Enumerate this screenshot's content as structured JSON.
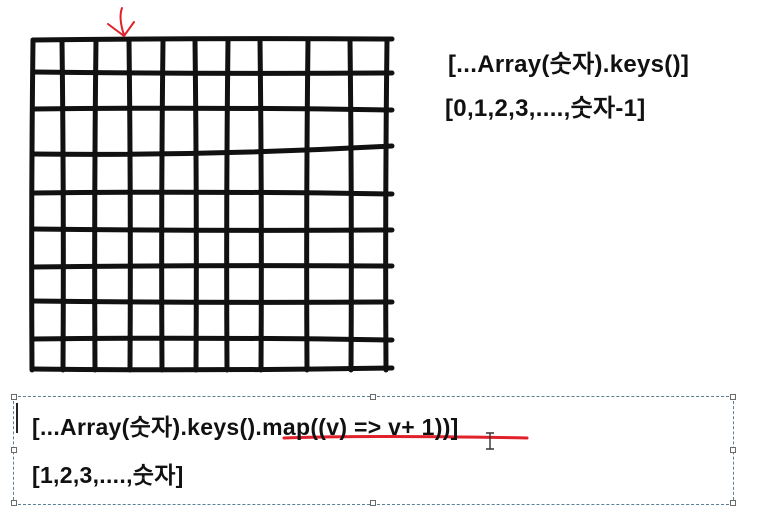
{
  "top_text": {
    "code": "[...Array(숫자).keys()]",
    "result": "[0,1,2,3,....,숫자-1]"
  },
  "text_box": {
    "code": "[...Array(숫자).keys().map((v) => v+ 1))]",
    "result": "[1,2,3,....,숫자]"
  },
  "colors": {
    "ink": "#111111",
    "underline": "#e0202a",
    "pointer_mark": "#e0202a",
    "box_border": "#5a7f96"
  },
  "grid": {
    "columns": 11,
    "rows": 10
  }
}
